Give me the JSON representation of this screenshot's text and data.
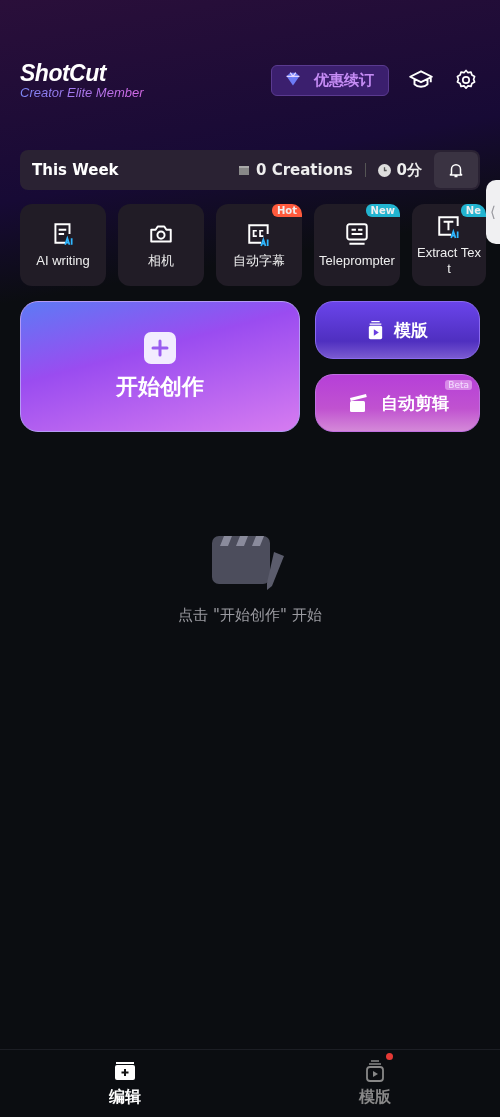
{
  "header": {
    "logo": "ShotCut",
    "membership": "Creator Elite Member",
    "promo_button": "优惠续订"
  },
  "stats": {
    "period": "This Week",
    "creations": "0 Creations",
    "duration": "0分"
  },
  "tools": [
    {
      "label": "AI writing",
      "kind": "writing"
    },
    {
      "label": "相机",
      "kind": "camera"
    },
    {
      "label": "自动字幕",
      "kind": "captions",
      "badge": {
        "text": "Hot",
        "color": "#ff5a3c"
      }
    },
    {
      "label": "Teleprompter",
      "kind": "teleprompter",
      "badge": {
        "text": "New",
        "color": "#22b4d0"
      }
    },
    {
      "label": "Extract Text",
      "kind": "extract",
      "badge": {
        "text": "Ne",
        "color": "#22b4d0"
      }
    }
  ],
  "create_button": "开始创作",
  "template_button": "模版",
  "auto_edit_button": {
    "label": "自动剪辑",
    "badge": "Beta"
  },
  "empty_state": "点击 \"开始创作\" 开始",
  "side_tab": "⟨",
  "nav": [
    {
      "label": "编辑",
      "selected": true,
      "kind": "edit",
      "dot": false
    },
    {
      "label": "模版",
      "selected": false,
      "kind": "template",
      "dot": true
    }
  ]
}
